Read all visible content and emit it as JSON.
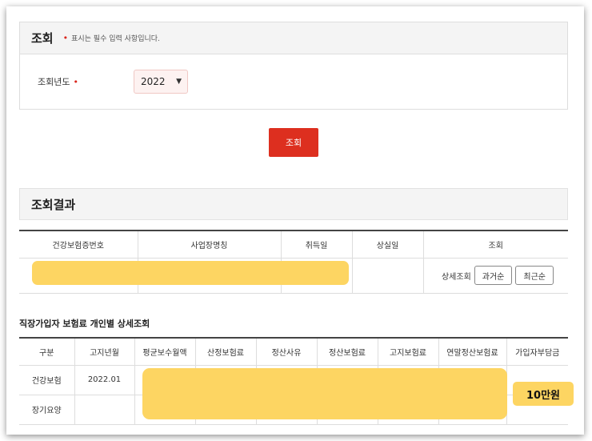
{
  "search_panel": {
    "title": "조회",
    "required_marker": "•",
    "required_note": "표시는 필수 입력 사항입니다.",
    "year_label": "조회년도",
    "year_required_marker": "•",
    "year_value": "2022"
  },
  "search_button": {
    "label": "조회"
  },
  "results": {
    "title": "조회결과",
    "columns": [
      "건강보험증번호",
      "사업장명칭",
      "취득일",
      "상실일",
      "조회"
    ],
    "row": {
      "action_label": "상세조회",
      "btn_past": "과거순",
      "btn_recent": "최근순"
    }
  },
  "detail": {
    "title": "직장가입자 보험료 개인별 상세조회",
    "columns": [
      "구분",
      "고지년월",
      "평균보수월액",
      "산정보험료",
      "정산사유",
      "정산보험료",
      "고지보험료",
      "연말정산보험료",
      "가입자부담금"
    ],
    "rows": [
      {
        "type": "건강보험",
        "month": "2022.01"
      },
      {
        "type": "장기요양",
        "month": ""
      }
    ],
    "amount_badge": "10만원"
  },
  "colors": {
    "accent_red": "#dd2f1f",
    "highlight_yellow": "#fdd562"
  }
}
